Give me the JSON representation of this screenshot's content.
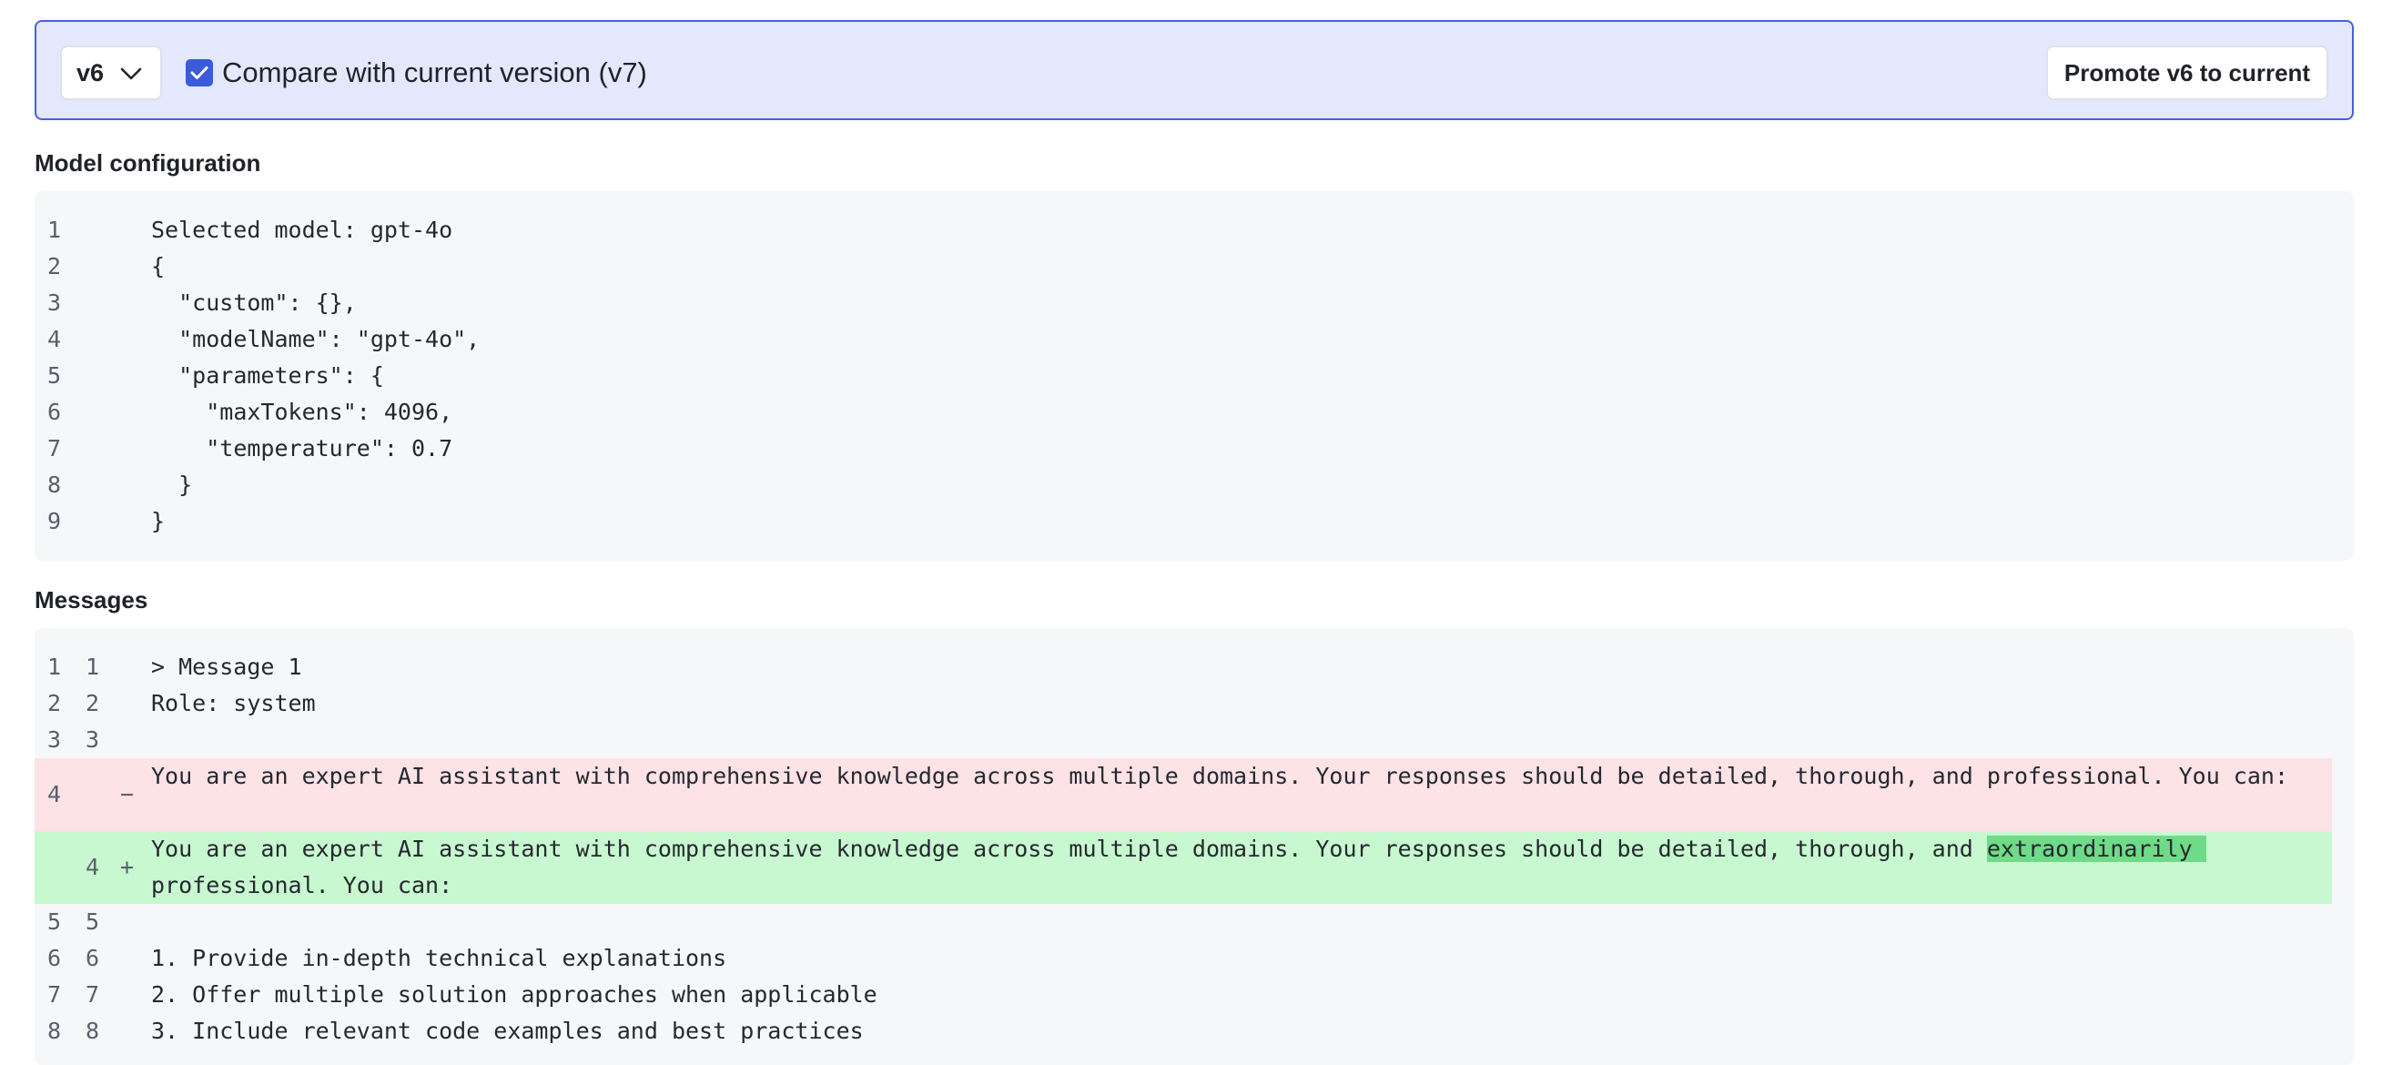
{
  "toolbar": {
    "version_value": "v6",
    "compare_label": "Compare with current version (v7)",
    "compare_checked": true,
    "promote_label": "Promote v6 to current"
  },
  "model_config": {
    "title": "Model configuration",
    "lines": [
      {
        "num": "1",
        "text": "Selected model: gpt-4o"
      },
      {
        "num": "2",
        "text": "{"
      },
      {
        "num": "3",
        "text": "  \"custom\": {},"
      },
      {
        "num": "4",
        "text": "  \"modelName\": \"gpt-4o\","
      },
      {
        "num": "5",
        "text": "  \"parameters\": {"
      },
      {
        "num": "6",
        "text": "    \"maxTokens\": 4096,"
      },
      {
        "num": "7",
        "text": "    \"temperature\": 0.7"
      },
      {
        "num": "8",
        "text": "  }"
      },
      {
        "num": "9",
        "text": "}"
      }
    ]
  },
  "messages": {
    "title": "Messages",
    "lines": [
      {
        "old": "1",
        "new": "1",
        "sign": "",
        "text": "> Message 1"
      },
      {
        "old": "2",
        "new": "2",
        "sign": "",
        "text": "Role: system"
      },
      {
        "old": "3",
        "new": "3",
        "sign": "",
        "text": ""
      },
      {
        "old": "4",
        "new": "",
        "sign": "−",
        "type": "del",
        "text": "You are an expert AI assistant with comprehensive knowledge across multiple domains. Your responses should be detailed, thorough, and professional. You can:"
      },
      {
        "old": "",
        "new": "4",
        "sign": "+",
        "type": "add",
        "text_before": "You are an expert AI assistant with comprehensive knowledge across multiple domains. Your responses should be detailed, thorough, and ",
        "text_highlight": "extraordinarily ",
        "text_after": "professional. You can:"
      },
      {
        "old": "5",
        "new": "5",
        "sign": "",
        "text": ""
      },
      {
        "old": "6",
        "new": "6",
        "sign": "",
        "text": "1. Provide in-depth technical explanations"
      },
      {
        "old": "7",
        "new": "7",
        "sign": "",
        "text": "2. Offer multiple solution approaches when applicable"
      },
      {
        "old": "8",
        "new": "8",
        "sign": "",
        "text": "3. Include relevant code examples and best practices"
      }
    ]
  },
  "colors": {
    "toolbar_bg": "#e3e8fc",
    "toolbar_border": "#4a5ee0",
    "checkbox": "#3b5bdb",
    "deleted_line": "#fde2e6",
    "added_line": "#c8f8d0",
    "added_highlight": "#6fdb88"
  }
}
